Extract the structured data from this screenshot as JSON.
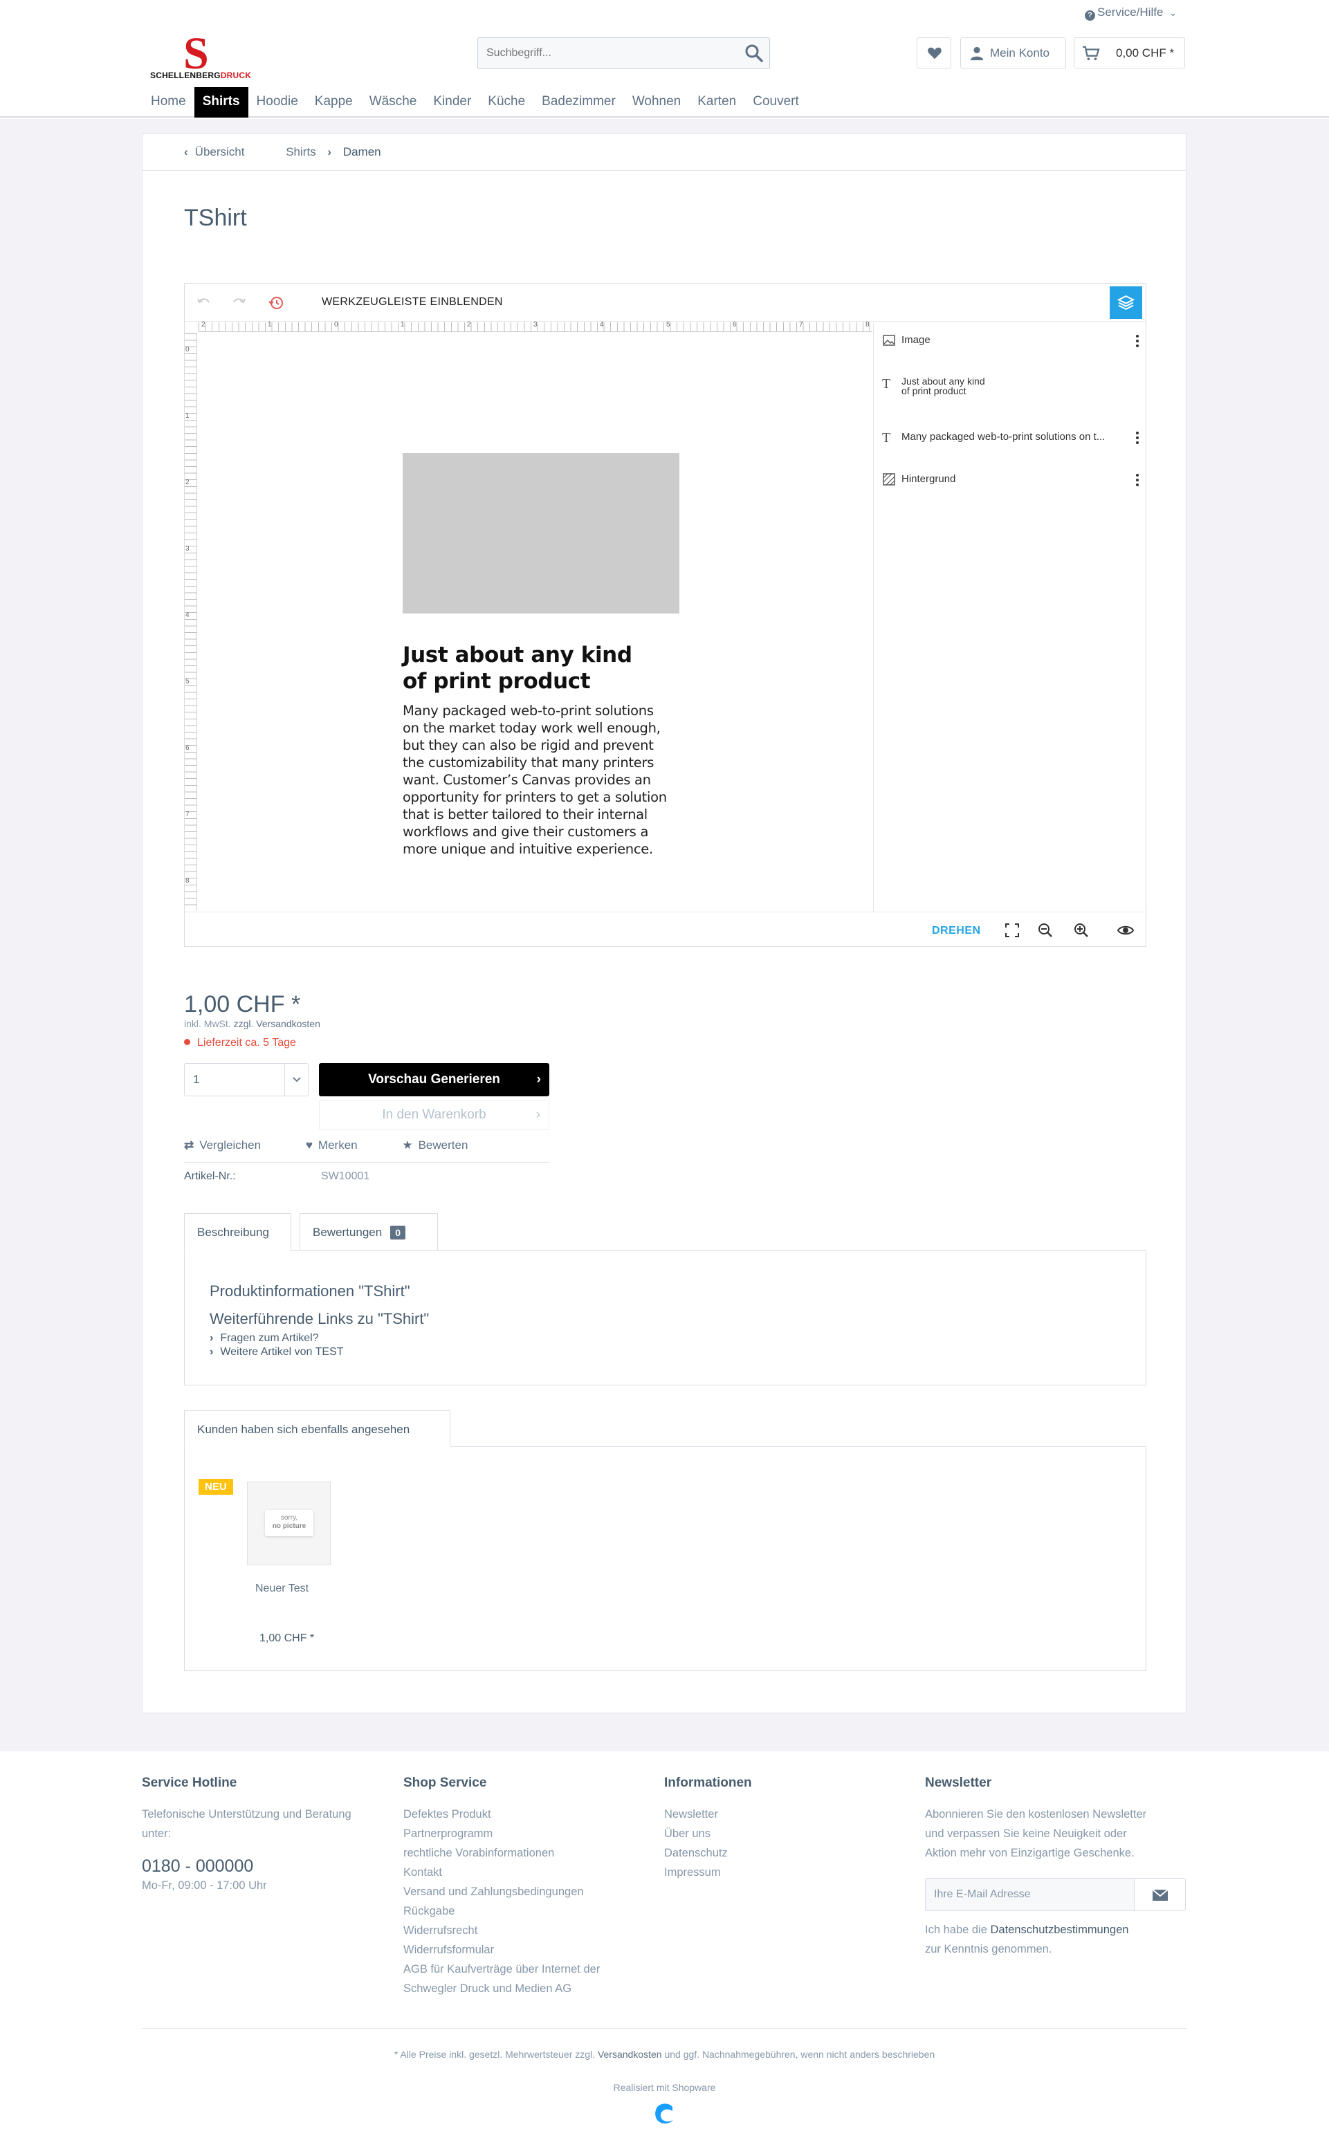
{
  "header": {
    "service": "Service/Hilfe",
    "logo_a": "SCHELLENBERG",
    "logo_b": "DRUCK",
    "logo_letter": "S",
    "search_placeholder": "Suchbegriff...",
    "account": "Mein Konto",
    "cart": "0,00 CHF *"
  },
  "nav": [
    "Home",
    "Shirts",
    "Hoodie",
    "Kappe",
    "Wäsche",
    "Kinder",
    "Küche",
    "Badezimmer",
    "Wohnen",
    "Karten",
    "Couvert"
  ],
  "nav_active": "Shirts",
  "breadcrumb": {
    "back": "Übersicht",
    "level1": "Shirts",
    "level2": "Damen"
  },
  "product": {
    "title": "TShirt",
    "price": "1,00 CHF *",
    "tax_a": "inkl. MwSt.",
    "tax_b": "zzgl. Versandkosten",
    "delivery": "Lieferzeit ca. 5 Tage",
    "quantity": "1",
    "preview_btn": "Vorschau Generieren",
    "cart_btn": "In den Warenkorb",
    "compare": "Vergleichen",
    "remember": "Merken",
    "rate": "Bewerten",
    "art_label": "Artikel-Nr.:",
    "art_value": "SW10001"
  },
  "editor": {
    "toolbar_label": "WERKZEUGLEISTE EINBLENDEN",
    "heading_l1": "Just about any kind",
    "heading_l2": "of print product",
    "body_lines": [
      "Many packaged web-to-print solutions",
      "on the market today work well enough,",
      "but they can also be rigid and prevent",
      "the customizability that many printers",
      "want. Customer’s Canvas provides an",
      "opportunity for printers to get a solution",
      "that is better tailored to their internal",
      "workflows and give their customers a",
      "more unique and intuitive experience."
    ],
    "layers": {
      "image": "Image",
      "text1_l1": "Just about any kind",
      "text1_l2": "of print product",
      "text2": "Many packaged web-to-print solutions on t...",
      "background": "Hintergrund"
    },
    "rotate": "DREHEN",
    "ruler_h": [
      "2",
      "1",
      "0",
      "1",
      "2",
      "3",
      "4",
      "5",
      "6",
      "7",
      "8"
    ],
    "ruler_v": [
      "0",
      "1",
      "2",
      "3",
      "4",
      "5",
      "6",
      "7",
      "8"
    ]
  },
  "tabs": {
    "description": "Beschreibung",
    "reviews": "Bewertungen",
    "reviews_count": "0",
    "info_title": "Produktinformationen \"TShirt\"",
    "links_title": "Weiterführende Links zu \"TShirt\"",
    "link1": "Fragen zum Artikel?",
    "link2": "Weitere Artikel von TEST"
  },
  "recommend": {
    "tab": "Kunden haben sich ebenfalls angesehen",
    "badge": "NEU",
    "nopic_l1": "sorry,",
    "nopic_l2": "no picture",
    "name": "Neuer Test",
    "price": "1,00 CHF *"
  },
  "footer": {
    "hotline_title": "Service Hotline",
    "hotline_text_l1": "Telefonische Unterstützung und Beratung",
    "hotline_text_l2": "unter:",
    "phone": "0180 - 000000",
    "hours": "Mo-Fr, 09:00 - 17:00 Uhr",
    "shop_title": "Shop Service",
    "shop_links": [
      "Defektes Produkt",
      "Partnerprogramm",
      "rechtliche Vorabinformationen",
      "Kontakt",
      "Versand und Zahlungsbedingungen",
      "Rückgabe",
      "Widerrufsrecht",
      "Widerrufsformular",
      "AGB für Kaufverträge über Internet der",
      "Schwegler Druck und Medien AG"
    ],
    "info_title": "Informationen",
    "info_links": [
      "Newsletter",
      "Über uns",
      "Datenschutz",
      "Impressum"
    ],
    "news_title": "Newsletter",
    "news_text": [
      "Abonnieren Sie den kostenlosen Newsletter",
      "und verpassen Sie keine Neuigkeit oder",
      "Aktion mehr von Einzigartige Geschenke."
    ],
    "email_placeholder": "Ihre E-Mail Adresse",
    "privacy_a": "Ich habe die",
    "privacy_link": "Datenschutzbestimmungen",
    "privacy_b": "zur Kenntnis genommen.",
    "legal_a": "* Alle Preise inkl. gesetzl. Mehrwertsteuer zzgl.",
    "legal_link": "Versandkosten",
    "legal_b": "und ggf. Nachnahmegebühren, wenn nicht anders beschrieben",
    "powered": "Realisiert mit Shopware"
  }
}
